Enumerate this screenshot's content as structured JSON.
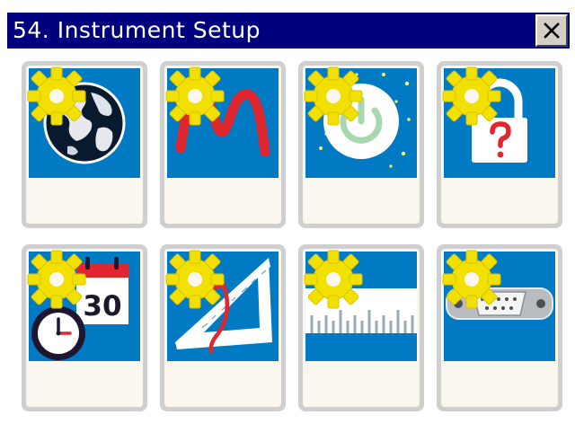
{
  "window": {
    "title": "54. Instrument Setup"
  },
  "tiles": [
    {
      "icon": "globe-icon"
    },
    {
      "icon": "measurement-curve-icon"
    },
    {
      "icon": "power-icon"
    },
    {
      "icon": "padlock-question-icon"
    },
    {
      "icon": "clock-calendar-icon",
      "calendar_day": "30"
    },
    {
      "icon": "set-square-icon"
    },
    {
      "icon": "scale-ruler-icon"
    },
    {
      "icon": "serial-port-icon"
    }
  ],
  "colors": {
    "titlebar": "#00007f",
    "tile_blue": "#007ac2",
    "gear_yellow": "#f2e100",
    "tile_border": "#cfcfcf"
  }
}
